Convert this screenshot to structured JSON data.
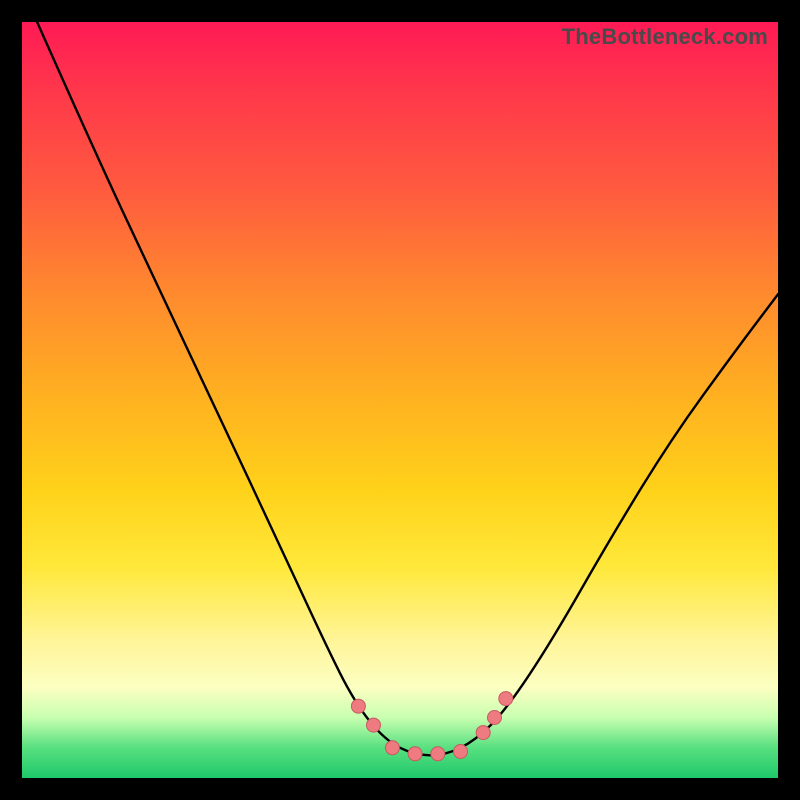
{
  "watermark": {
    "text": "TheBottleneck.com"
  },
  "colors": {
    "frame": "#000000",
    "curve": "#000000",
    "marker_fill": "#ee7b80",
    "marker_stroke": "#c75a60"
  },
  "chart_data": {
    "type": "line",
    "title": "",
    "xlabel": "",
    "ylabel": "",
    "xlim": [
      0,
      100
    ],
    "ylim": [
      0,
      100
    ],
    "grid": false,
    "legend": false,
    "series": [
      {
        "name": "bottleneck-curve",
        "x": [
          2,
          10,
          18,
          26,
          34,
          40,
          44,
          48,
          52,
          56,
          60,
          64,
          70,
          78,
          86,
          94,
          100
        ],
        "y": [
          100,
          82,
          65,
          48,
          31,
          18,
          10,
          5,
          3,
          3,
          5,
          9,
          18,
          32,
          45,
          56,
          64
        ]
      }
    ],
    "markers": [
      {
        "x": 44.5,
        "y": 9.5
      },
      {
        "x": 46.5,
        "y": 7.0
      },
      {
        "x": 49.0,
        "y": 4.0
      },
      {
        "x": 52.0,
        "y": 3.2
      },
      {
        "x": 55.0,
        "y": 3.2
      },
      {
        "x": 58.0,
        "y": 3.5
      },
      {
        "x": 61.0,
        "y": 6.0
      },
      {
        "x": 62.5,
        "y": 8.0
      },
      {
        "x": 64.0,
        "y": 10.5
      }
    ]
  }
}
